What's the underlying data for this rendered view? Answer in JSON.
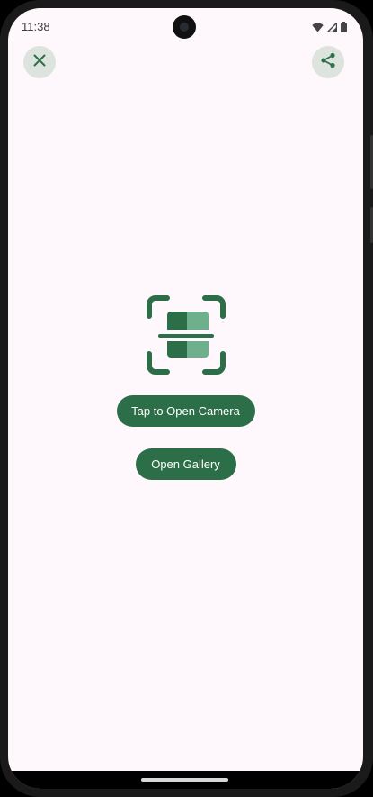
{
  "status_bar": {
    "time": "11:38",
    "icons": [
      "wifi-icon",
      "signal-icon",
      "battery-icon"
    ]
  },
  "toolbar": {
    "close_icon": "close-icon",
    "share_icon": "share-icon"
  },
  "main": {
    "scan_icon": "document-scanner-icon",
    "camera_button_label": "Tap to Open Camera",
    "gallery_button_label": "Open Gallery"
  },
  "colors": {
    "background": "#fef7fc",
    "accent": "#2c6e48",
    "accent_light": "#6db08b",
    "icon_button_bg": "#dde3dd"
  }
}
